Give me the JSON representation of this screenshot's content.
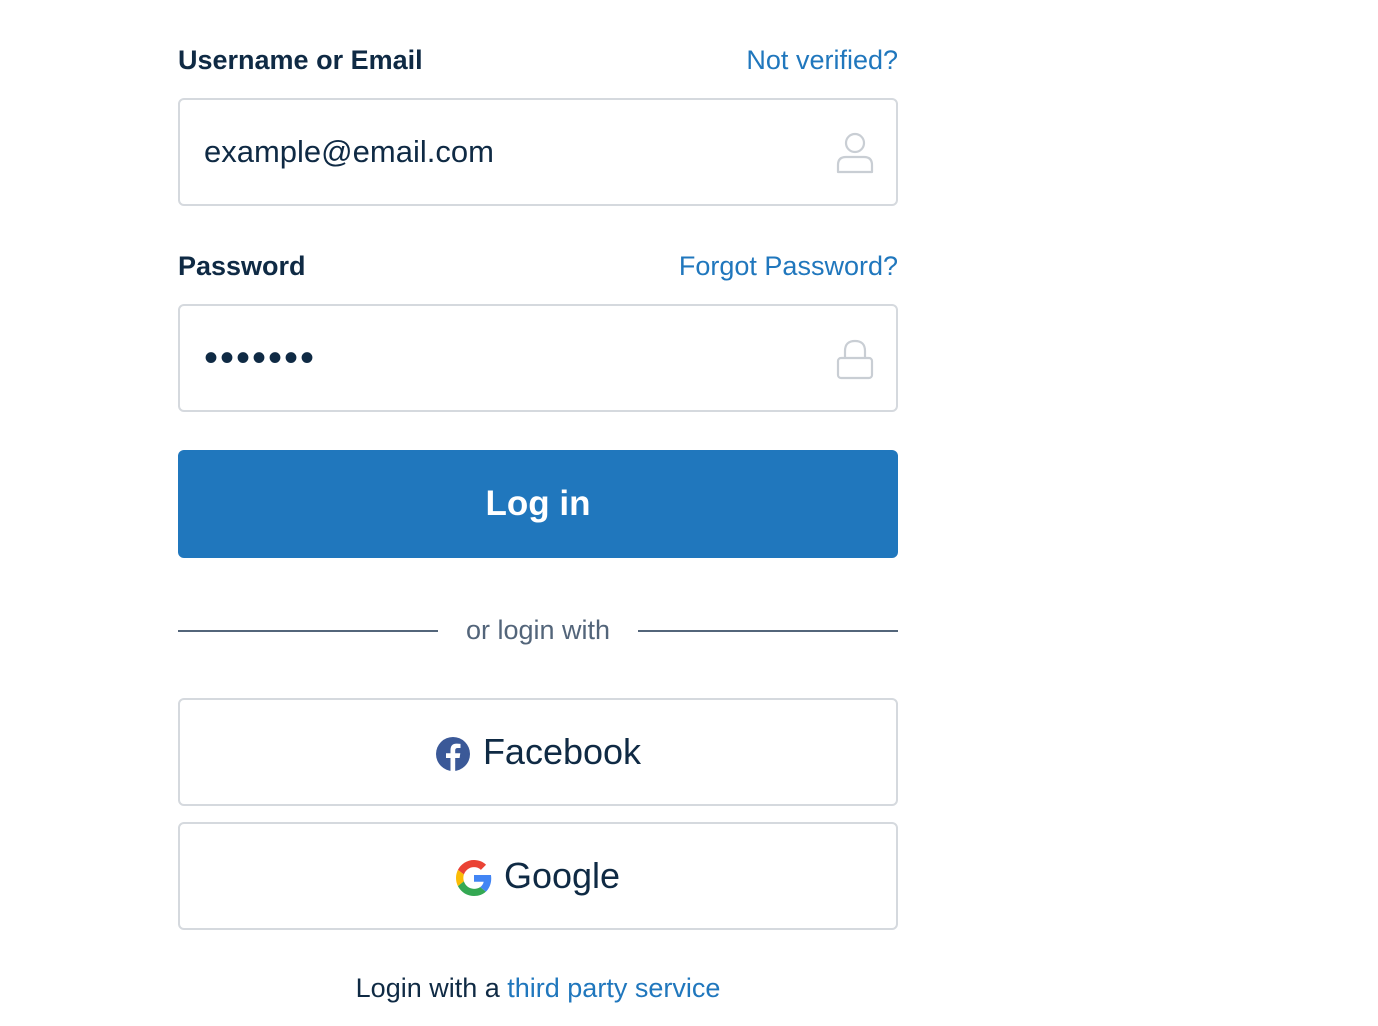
{
  "username": {
    "label": "Username or Email",
    "help_link": "Not verified?",
    "value": "example@email.com",
    "icon": "user-icon"
  },
  "password": {
    "label": "Password",
    "help_link": "Forgot Password?",
    "value": "•••••••",
    "icon": "lock-icon"
  },
  "login_button": {
    "label": "Log in"
  },
  "divider": {
    "text": "or login with"
  },
  "social": {
    "facebook_label": "Facebook",
    "facebook_icon": "facebook-icon",
    "google_label": "Google",
    "google_icon": "google-icon"
  },
  "footer": {
    "prefix": "Login with a",
    "link": "third party service"
  },
  "colors": {
    "accent": "#2077bd",
    "text": "#0f2a44",
    "border": "#d5d9de",
    "muted": "#53657a",
    "facebook": "#3b5998"
  }
}
